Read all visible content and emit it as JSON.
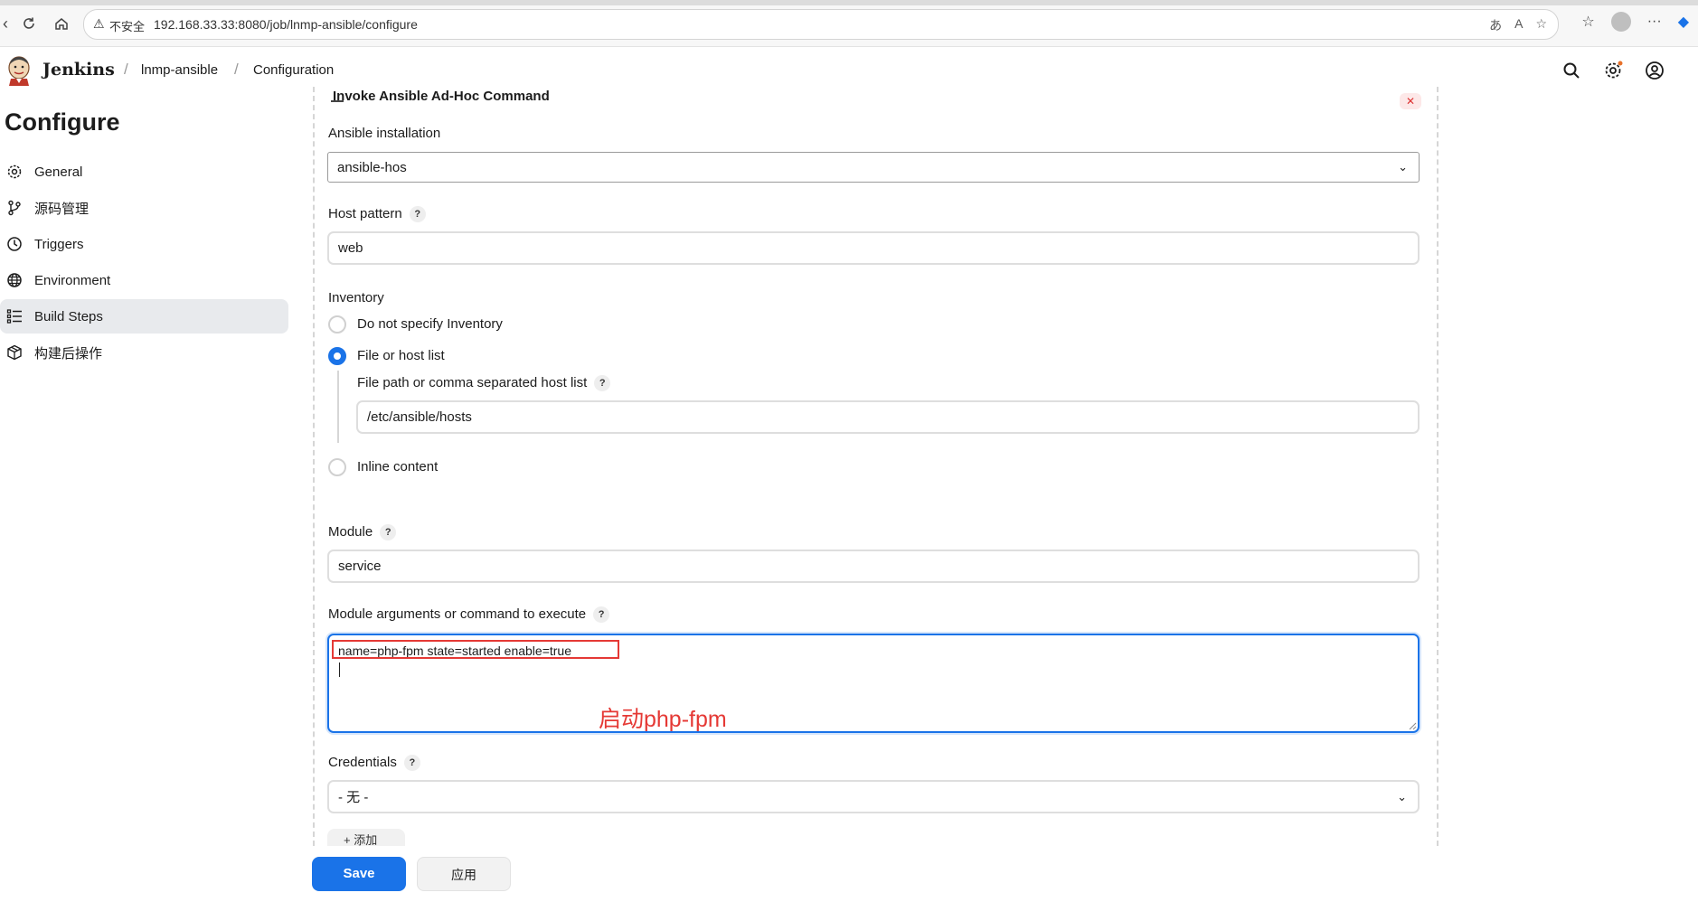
{
  "browser": {
    "security_label": "不安全",
    "url": "192.168.33.33:8080/job/lnmp-ansible/configure"
  },
  "header": {
    "brand": "Jenkins",
    "breadcrumbs": [
      "lnmp-ansible",
      "Configuration"
    ]
  },
  "sidebar": {
    "title": "Configure",
    "items": [
      {
        "label": "General",
        "icon": "gear-icon"
      },
      {
        "label": "源码管理",
        "icon": "branch-icon"
      },
      {
        "label": "Triggers",
        "icon": "clock-icon"
      },
      {
        "label": "Environment",
        "icon": "globe-icon"
      },
      {
        "label": "Build Steps",
        "icon": "list-icon",
        "active": true
      },
      {
        "label": "构建后操作",
        "icon": "package-icon"
      }
    ]
  },
  "form": {
    "section_title": "Invoke Ansible Ad-Hoc Command",
    "ansible_installation": {
      "label": "Ansible installation",
      "value": "ansible-hos"
    },
    "host_pattern": {
      "label": "Host pattern",
      "value": "web"
    },
    "inventory": {
      "label": "Inventory",
      "options": [
        "Do not specify Inventory",
        "File or host list",
        "Inline content"
      ],
      "selected": "File or host list",
      "file_path_label": "File path or comma separated host list",
      "file_path_value": "/etc/ansible/hosts"
    },
    "module": {
      "label": "Module",
      "value": "service"
    },
    "module_args": {
      "label": "Module arguments or command to execute",
      "value": "name=php-fpm state=started enable=true"
    },
    "annotation": "启动php-fpm",
    "credentials": {
      "label": "Credentials",
      "value": "- 无 -"
    },
    "add_button": "添加"
  },
  "actions": {
    "save": "Save",
    "apply": "应用"
  },
  "colors": {
    "accent": "#1a73e8",
    "annotation": "#e53935"
  }
}
